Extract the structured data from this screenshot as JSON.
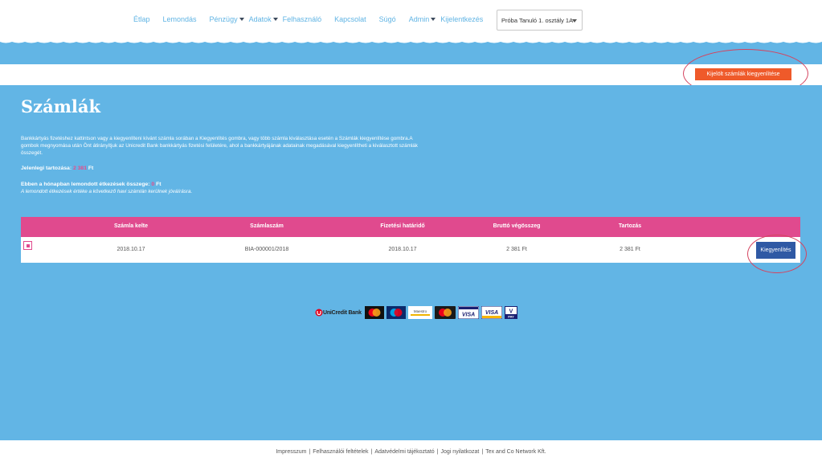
{
  "nav": {
    "items": [
      {
        "label": "Étlap",
        "dropdown": false
      },
      {
        "label": "Lemondás",
        "dropdown": false
      },
      {
        "label": "Pénzügy",
        "dropdown": true
      },
      {
        "label": "Adatok",
        "dropdown": true
      },
      {
        "label": "Felhasználó",
        "dropdown": false
      },
      {
        "label": "Kapcsolat",
        "dropdown": false
      },
      {
        "label": "Súgó",
        "dropdown": false
      },
      {
        "label": "Admin",
        "dropdown": true
      },
      {
        "label": "Kijelentkezés",
        "dropdown": false
      }
    ],
    "user_select": "Próba Tanuló 1. osztály 1A"
  },
  "actions": {
    "pay_selected_label": "Kijelölt számlák kiegyenlítése"
  },
  "page": {
    "title": "Számlák",
    "intro": "Bankkártyás fizetéshez kattintson vagy a kiegyenlíteni kívánt számla sorában a Kiegyenlítés gombra, vagy több számla kiválasztása esetén a Számlák kiegyenlítése gombra.A gombok megnyomása után Önt átirányítjuk az Unicredit Bank bankkártyás fizetési felületére, ahol a bankkártyájának adatainak megadásával kiegyenlítheti a kiválasztott számlák összegét.",
    "debt_label": "Jelenlegi tartozása:",
    "debt_value": "2 381",
    "debt_unit": "Ft",
    "cancel_label": "Ebben a hónapban lemondott étkezések összege:",
    "cancel_value": "0",
    "cancel_unit": "Ft",
    "cancel_note": "A lemondott étkezések értéke a következő havi számlán kerülnek jóváírásra."
  },
  "table": {
    "headers": [
      "Számla kelte",
      "Számlaszám",
      "Fizetési határidő",
      "Bruttó végösszeg",
      "Tartozás"
    ],
    "rows": [
      {
        "date": "2018.10.17",
        "number": "BIA-000001/2018",
        "due": "2018.10.17",
        "gross": "2 381 Ft",
        "debt": "2 381 Ft",
        "pay_label": "Kiegyenlítés"
      }
    ]
  },
  "payment_logos": {
    "unicredit": "UniCredit Bank",
    "maestro_text": "Maestro",
    "visa": "VISA",
    "vpay_v": "V",
    "vpay_pay": "PAY"
  },
  "footer": {
    "links": [
      "Impresszum",
      "Felhasználói feltételek",
      "Adatvédelmi tájékoztató",
      "Jogi nyilatkozat",
      "Tex and Co Network Kft."
    ],
    "separator": "|"
  },
  "colors": {
    "accent_orange": "#ef5a2a",
    "table_header_pink": "#e04a8e",
    "main_blue": "#62b5e5",
    "button_blue": "#2f59a4",
    "highlight_ellipse": "#d5435f"
  }
}
